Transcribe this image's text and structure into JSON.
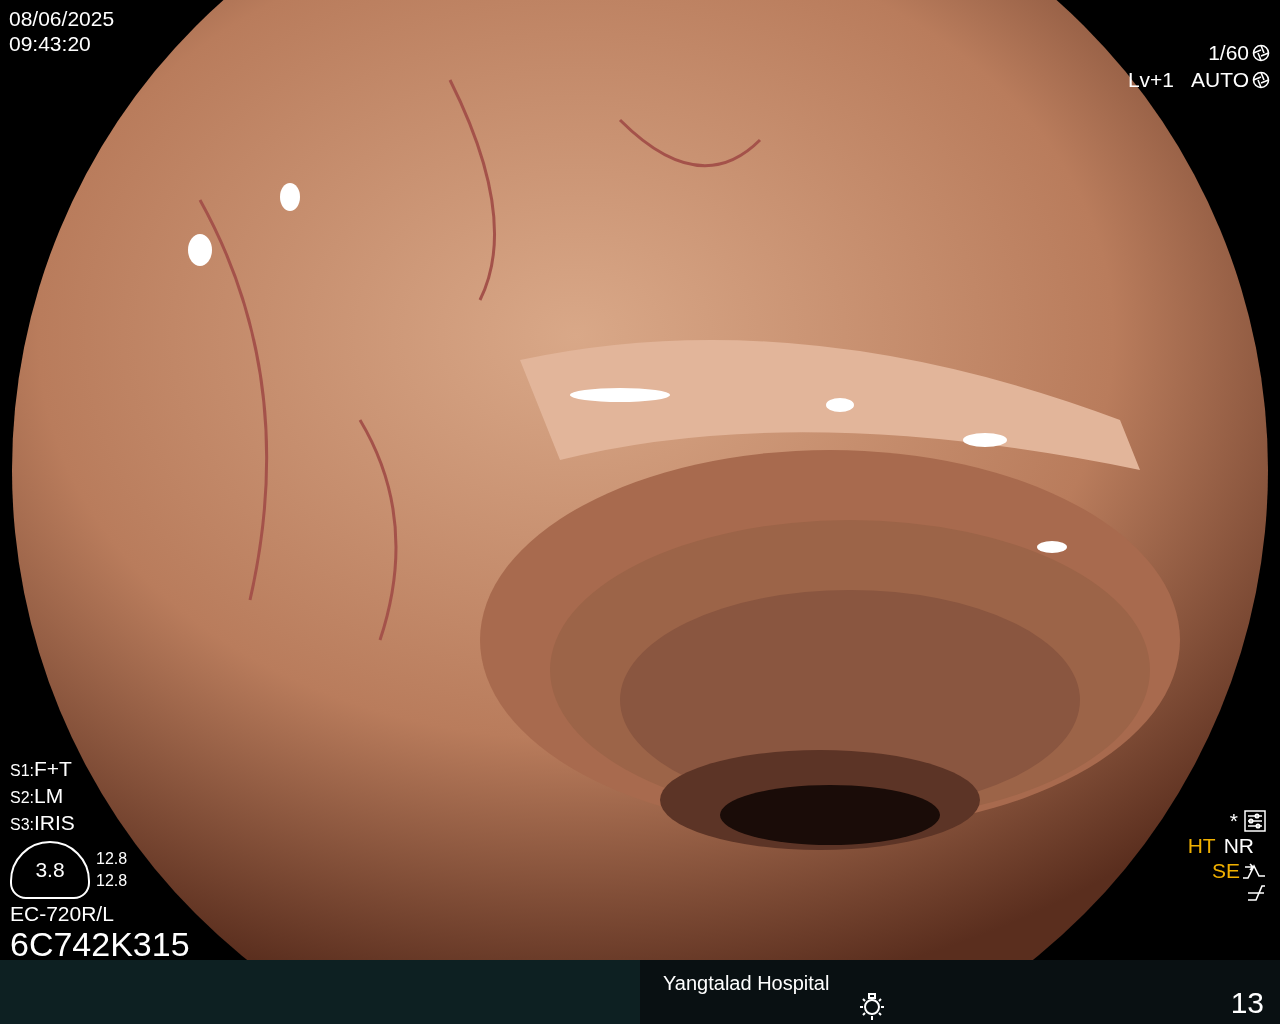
{
  "date": "08/06/2025",
  "time": "09:43:20",
  "shutter": "1/60",
  "brightness_level": "Lv+1",
  "iris_mode": "AUTO",
  "settings": [
    {
      "key": "S1:",
      "value": "F+T"
    },
    {
      "key": "S2:",
      "value": "LM"
    },
    {
      "key": "S3:",
      "value": "IRIS"
    }
  ],
  "zoom": {
    "value": "3.8",
    "readings": [
      "12.8",
      "12.8"
    ]
  },
  "scope_model": "EC-720R/L",
  "serial": "6C742K315",
  "mark": "*",
  "modes": [
    {
      "label": "HT",
      "color": "#f0b000"
    },
    {
      "label": "NR",
      "color": "#ffffff"
    },
    {
      "label": "SE",
      "color": "#f0b000"
    }
  ],
  "footer": {
    "hospital": "Yangtalad Hospital",
    "count": "13"
  }
}
